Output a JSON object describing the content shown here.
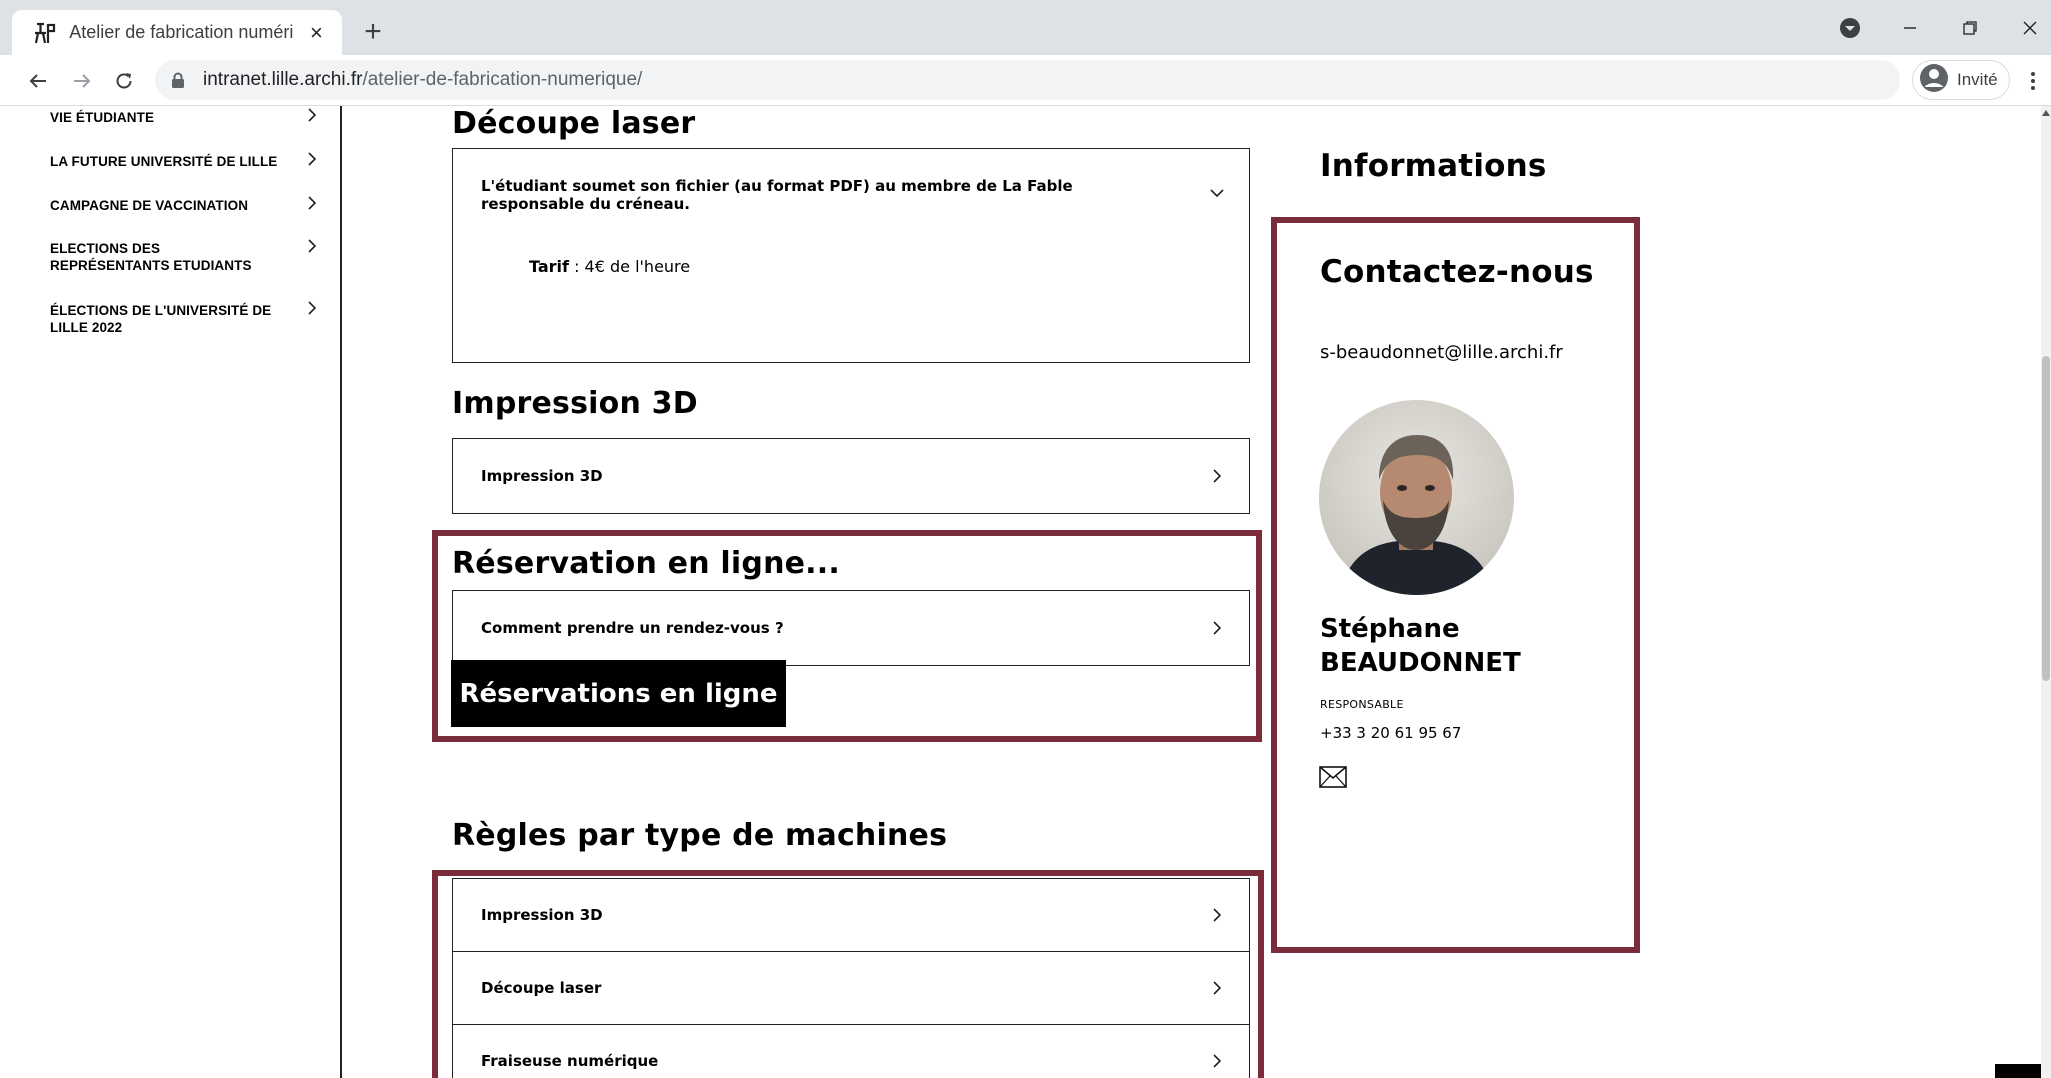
{
  "browser": {
    "tab_title": "Atelier de fabrication numérique",
    "tab_close": "×",
    "new_tab": "+",
    "url_host": "intranet.lille.archi.fr",
    "url_path": "/atelier-de-fabrication-numerique/",
    "profile_label": "Invité"
  },
  "sidebar": {
    "items": [
      {
        "label": "VIE ÉTUDIANTE"
      },
      {
        "label": "LA FUTURE UNIVERSITÉ DE LILLE"
      },
      {
        "label": "CAMPAGNE DE VACCINATION"
      },
      {
        "label": "ELECTIONS DES REPRÉSENTANTS ETUDIANTS"
      },
      {
        "label": "ÉLECTIONS DE L'UNIVERSITÉ DE LILLE 2022"
      }
    ]
  },
  "main": {
    "laser": {
      "heading": "Découpe laser",
      "accordion_title": "L'étudiant soumet son fichier (au format PDF) au membre de La Fable responsable du créneau.",
      "tarif_label": "Tarif",
      "tarif_value": " : 4€ de l'heure"
    },
    "print3d": {
      "heading": "Impression 3D",
      "accordion_title": "Impression 3D"
    },
    "reservation": {
      "heading": "Réservation en ligne...",
      "accordion_title": "Comment prendre un rendez-vous ?",
      "button_label": "Réservations en ligne"
    },
    "rules": {
      "heading": "Règles par type de machines",
      "items": [
        {
          "label": "Impression 3D"
        },
        {
          "label": "Découpe laser"
        },
        {
          "label": "Fraiseuse numérique"
        }
      ]
    }
  },
  "info": {
    "heading": "Informations",
    "contact_heading": "Contactez-nous",
    "email": "s-beaudonnet@lille.archi.fr",
    "name": "Stéphane BEAUDONNET",
    "role": "RESPONSABLE",
    "phone": "+33 3 20 61 95 67"
  },
  "colors": {
    "highlight_border": "#7a2c3a",
    "button_bg": "#000000",
    "chrome_bg": "#dee1e6"
  },
  "icons": [
    "fable-logo-icon",
    "close-icon",
    "plus-icon",
    "dropdown-icon",
    "minimize-icon",
    "restore-icon",
    "window-close-icon",
    "back-icon",
    "forward-icon",
    "reload-icon",
    "lock-icon",
    "profile-icon",
    "menu-dots-icon",
    "chevron-right-icon",
    "chevron-down-icon",
    "mail-icon"
  ]
}
